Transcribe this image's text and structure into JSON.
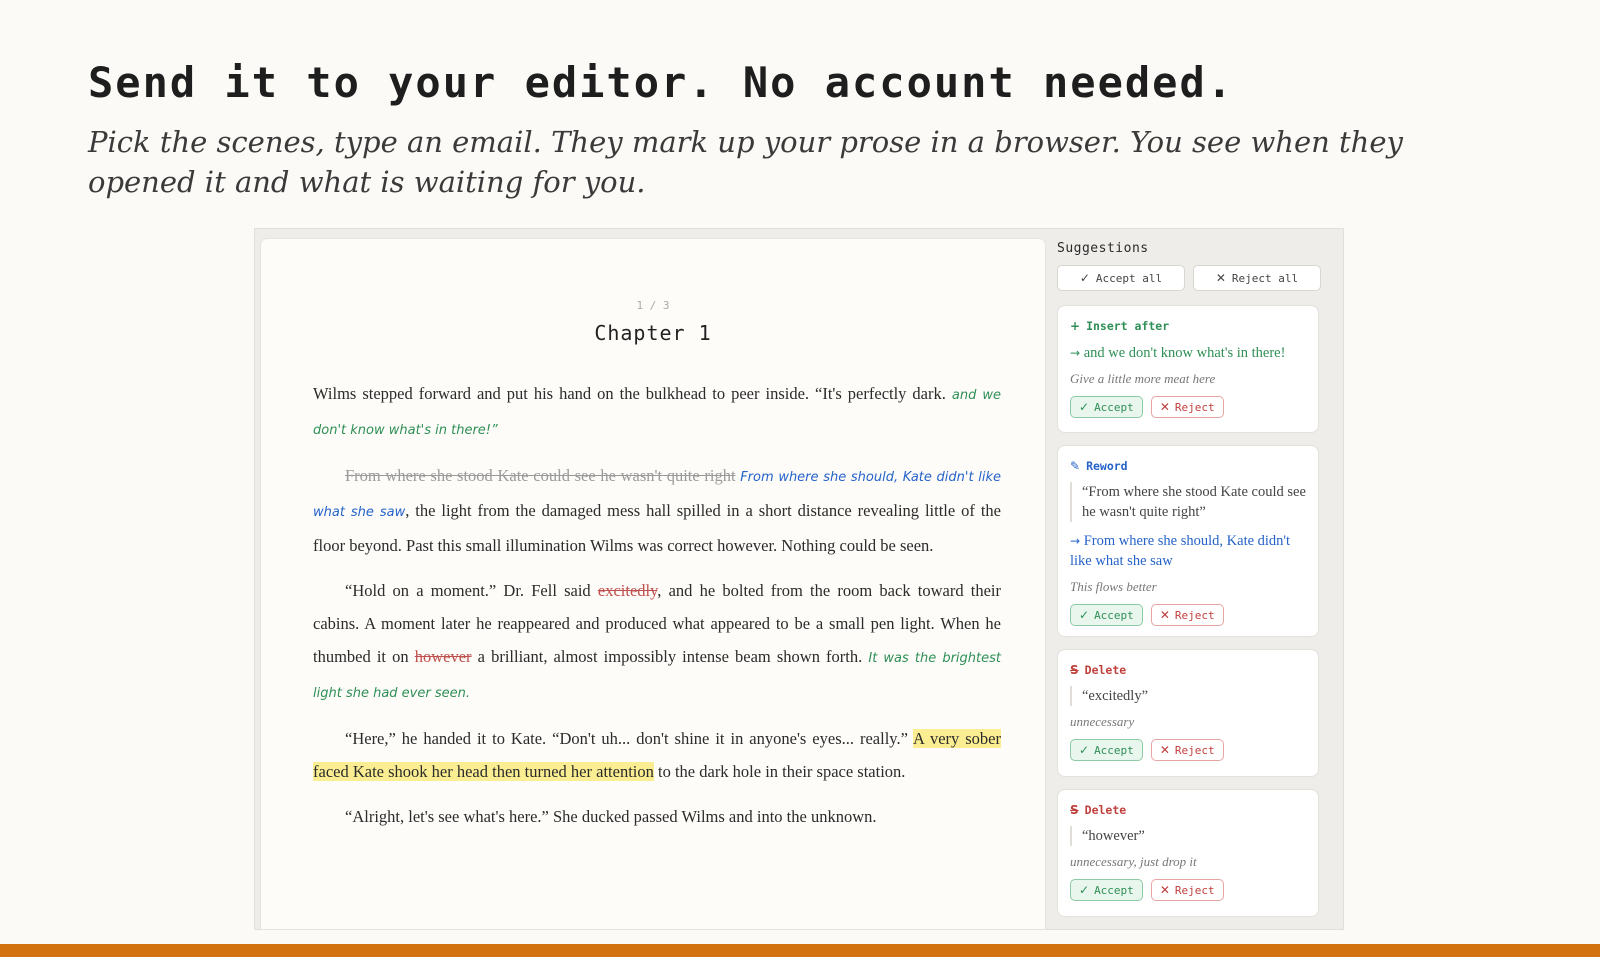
{
  "hero": {
    "headline": "Send it to your editor. No account needed.",
    "subline": "Pick the scenes, type an email. They mark up your prose in a browser. You see when they opened it and what is waiting for you."
  },
  "manuscript": {
    "page_counter": "1 / 3",
    "chapter_title": "Chapter 1",
    "p1": {
      "text": "Wilms stepped forward and put his hand on the bulkhead to peer inside. “It's perfectly dark.",
      "insert": "and we don't know what's in there!"
    },
    "p2": {
      "deleted": "From where she stood Kate could see he wasn't quite right",
      "inserted": "From where she should, Kate didn't like what she saw",
      "text": ", the light from the damaged mess hall spilled in a short distance revealing little of the floor beyond. Past this small illumination Wilms was correct however. Nothing could be seen."
    },
    "p3": {
      "text_a": "“Hold on a moment.” Dr. Fell said ",
      "deleted_a": "excitedly",
      "text_b": ", and he bolted from the room back toward their cabins. A moment later he reappeared and produced what appeared to be a small pen light. When he thumbed it on ",
      "deleted_b": "however",
      "text_c": " a brilliant, almost impossibly intense beam shown forth.",
      "insert": "It was the brightest light she had ever seen."
    },
    "p4": {
      "text_a": "“Here,” he handed it to Kate. “Don't uh... don't shine it in anyone's eyes... really.” ",
      "highlight": "A very sober faced Kate shook her head then turned her attention",
      "text_b": " to the dark hole in their space station."
    },
    "p5": {
      "text": "“Alright, let's see what's here.” She ducked passed Wilms and into the unknown."
    }
  },
  "suggestions": {
    "title": "Suggestions",
    "accept_all": "Accept all",
    "reject_all": "Reject all",
    "accept_label": "Accept",
    "reject_label": "Reject",
    "cards": [
      {
        "type": "Insert after",
        "proposed": "and we don't know what's in there!",
        "note": "Give a little more meat here"
      },
      {
        "type": "Reword",
        "original": "“From where she stood Kate could see he wasn't quite right”",
        "proposed": "From where she should, Kate didn't like what she saw",
        "note": "This flows better"
      },
      {
        "type": "Delete",
        "original": "“excitedly”",
        "note": "unnecessary"
      },
      {
        "type": "Delete",
        "original": "“however”",
        "note": "unnecessary, just drop it"
      }
    ]
  },
  "colors": {
    "insert": "#2f8f56",
    "reword": "#2563c9",
    "delete": "#c0403c",
    "highlight": "#fbee92",
    "footer_bar": "#d2720f"
  }
}
